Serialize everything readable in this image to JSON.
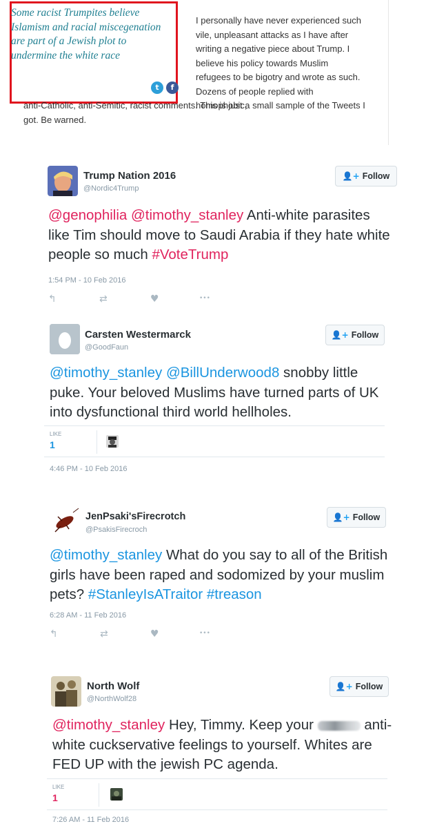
{
  "article": {
    "pullquote": "Some racist Trumpites believe Islamism and racial miscegenation are part of a Jewish plot to undermine the white race",
    "share_twitter_glyph": "t",
    "share_facebook_glyph": "f",
    "body_right": "I personally have never experienced such vile, unpleasant attacks as I have after writing a negative piece about Trump. I believe his policy towards Muslim refugees to be bigotry and wrote as such. Dozens of people replied with homophobic,",
    "body_full": "anti-Catholic, anti-Semitic, racist comments. This is just a small sample of the Tweets I got. Be warned."
  },
  "follow_label": "Follow",
  "tweets": [
    {
      "name": "Trump Nation 2016",
      "handle": "@Nordic4Trump",
      "text": {
        "m1": "@genophilia",
        "m2": "@timothy_stanley",
        "body": " Anti-white parasites like Tim should move to Saudi Arabia if they hate white people so much ",
        "tag": "#VoteTrump"
      },
      "time": "1:54 PM - 10 Feb 2016",
      "actions": {
        "reply": "↰",
        "retweet": "⇄",
        "like": "♥",
        "more": "•••"
      }
    },
    {
      "name": "Carsten Westermarck",
      "handle": "@GoodFaun",
      "text": {
        "m1": "@timothy_stanley",
        "m2": "@BillUnderwood8",
        "body": " snobby little puke. Your beloved Muslims have turned parts of UK into dysfunctional third world hellholes."
      },
      "likes_label": "LIKE",
      "likes_count": "1",
      "time": "4:46 PM - 10 Feb 2016"
    },
    {
      "name": "JenPsaki'sFirecrotch",
      "handle": "@PsakisFirecroch",
      "text": {
        "m1": "@timothy_stanley",
        "body": " What do you say to all of the British girls have been raped and sodomized by your muslim pets?",
        "tag1": "#StanleyIsATraitor",
        "tag2": "#treason"
      },
      "time": "6:28 AM - 11 Feb 2016",
      "actions": {
        "reply": "↰",
        "retweet": "⇄",
        "like": "♥",
        "more": "•••"
      }
    },
    {
      "name": "North Wolf",
      "handle": "@NorthWolf28",
      "text": {
        "m1": "@timothy_stanley",
        "body1": " Hey, Timmy.  Keep your ",
        "body2": " anti-white cuckservative feelings to yourself. Whites are FED UP with the jewish PC agenda."
      },
      "likes_label": "LIKE",
      "likes_count": "1",
      "time": "7:26 AM - 11 Feb 2016"
    }
  ],
  "colors": {
    "quote_border": "#e0141e",
    "quote_text": "#1f7f91",
    "mention_red": "#e0245e",
    "mention_blue": "#1b95e0",
    "twitter_blue": "#1da1f2",
    "facebook_blue": "#3b5998"
  }
}
